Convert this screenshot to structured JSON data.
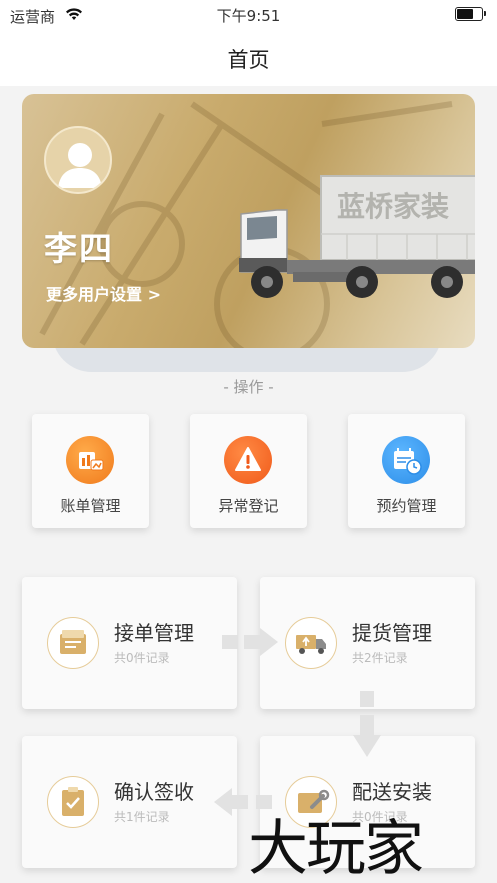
{
  "status_bar": {
    "carrier": "运营商",
    "time": "下午9:51",
    "battery_level": 0.6
  },
  "nav": {
    "title": "首页"
  },
  "banner": {
    "user_name": "李四",
    "more_settings": "更多用户设置 >",
    "truck_text": "蓝桥家装"
  },
  "section": {
    "label": "- 操作 -"
  },
  "operations": [
    {
      "label": "账单管理",
      "icon": "bill-chart-icon",
      "color": "#f07a1c"
    },
    {
      "label": "异常登记",
      "icon": "warning-icon",
      "color": "#f05a1a"
    },
    {
      "label": "预约管理",
      "icon": "calendar-clock-icon",
      "color": "#2d8ee8"
    }
  ],
  "flow": [
    {
      "name": "接单管理",
      "count": "共0件记录",
      "icon": "order-box-icon"
    },
    {
      "name": "提货管理",
      "count": "共2件记录",
      "icon": "pickup-truck-icon"
    },
    {
      "name": "确认签收",
      "count": "共1件记录",
      "icon": "clipboard-check-icon"
    },
    {
      "name": "配送安装",
      "count": "共0件记录",
      "icon": "install-wrench-icon"
    }
  ],
  "watermark": {
    "text": "大玩家"
  }
}
